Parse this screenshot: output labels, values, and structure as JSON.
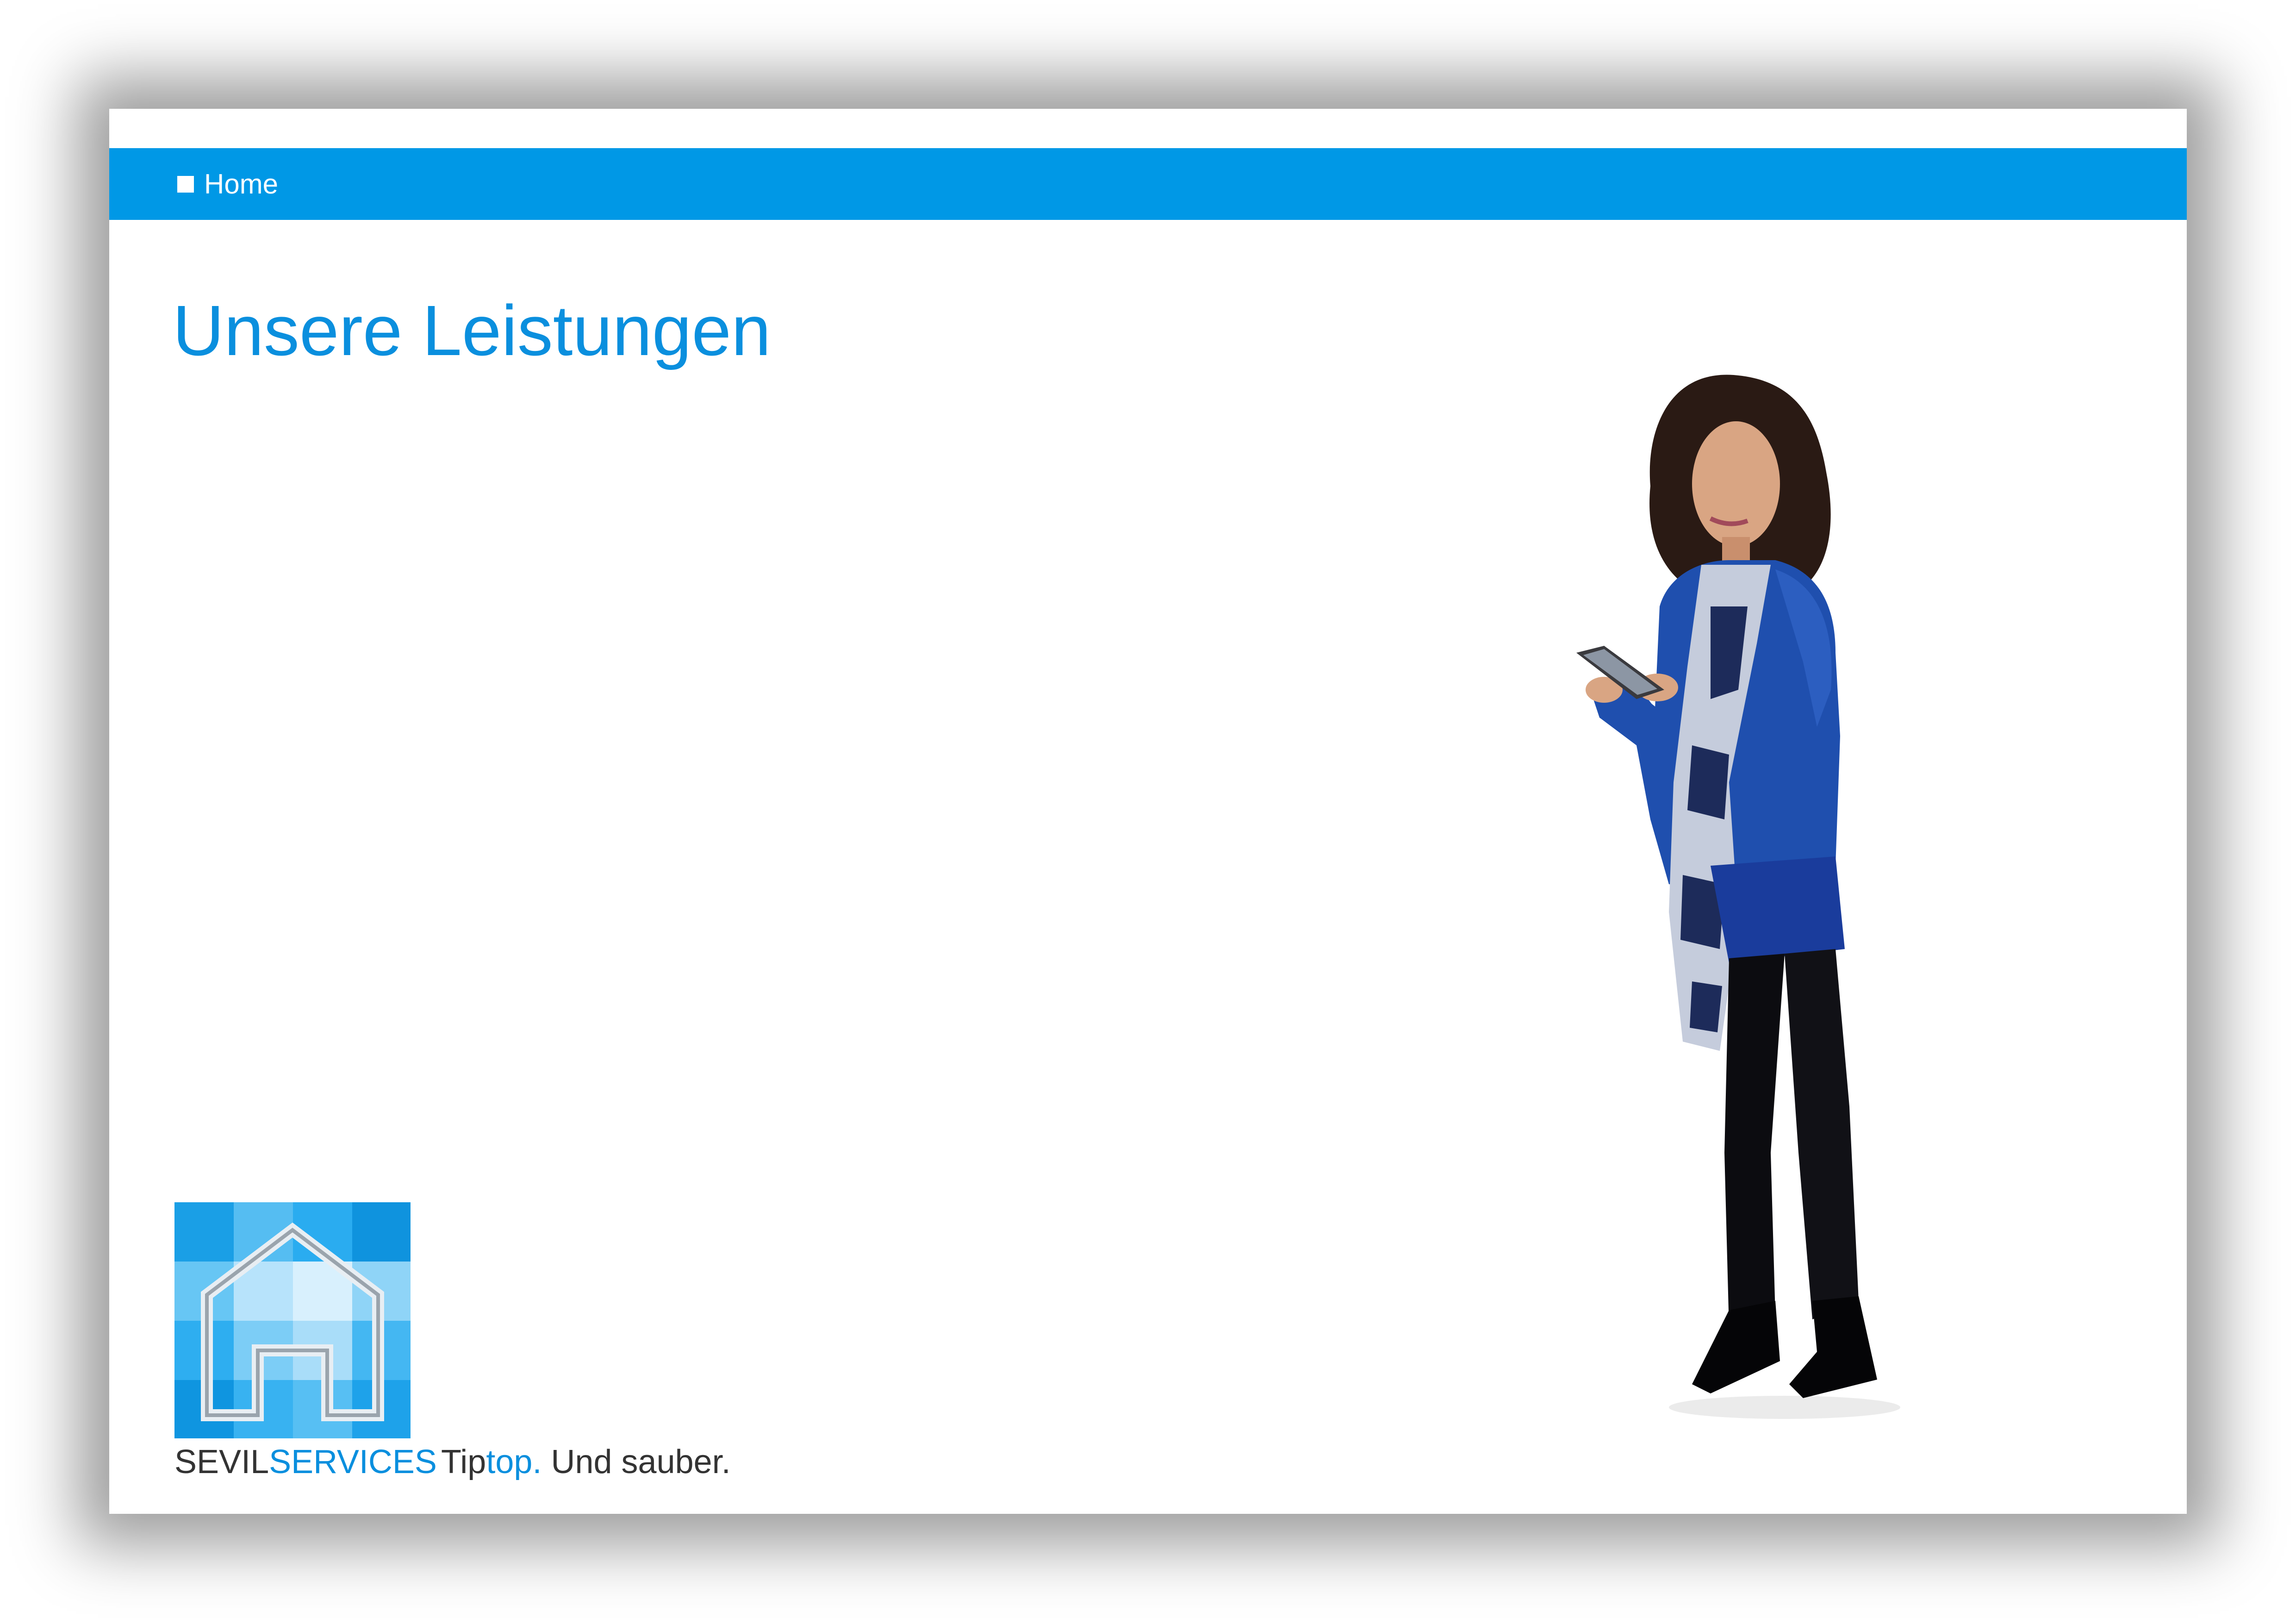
{
  "nav": {
    "items": [
      {
        "label": "Home",
        "icon": "square-bullet-icon"
      }
    ]
  },
  "main": {
    "title": "Unsere Leistungen"
  },
  "branding": {
    "name_part1": "SEVIL",
    "name_part2": "SERVICES",
    "tagline_part1": "Tip",
    "tagline_part2": "top.",
    "tagline_part3": " Und sauber."
  },
  "colors": {
    "accent": "#0098e6",
    "title_blue": "#0a8fde",
    "text_dark": "#333333"
  }
}
